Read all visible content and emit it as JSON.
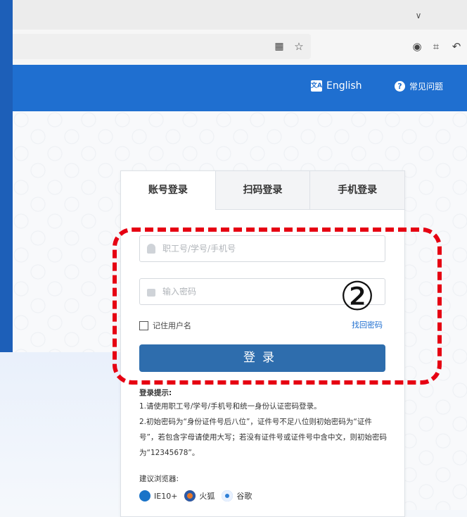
{
  "browser": {
    "tab_chevron_icon": "chevron-down-icon",
    "toolbar_icons": [
      "qr-code-icon",
      "star-icon",
      "account-icon",
      "crop-icon",
      "back-icon"
    ]
  },
  "header": {
    "english_label": "English",
    "faq_label": "常见问题",
    "background_color": "#1f6fd0"
  },
  "login": {
    "tabs": [
      "账号登录",
      "扫码登录",
      "手机登录"
    ],
    "active_tab": 0,
    "username_placeholder": "职工号/学号/手机号",
    "password_placeholder": "输入密码",
    "remember_label": "记住用户名",
    "forgot_label": "找回密码",
    "submit_label": "登录",
    "button_color": "#2e6dad"
  },
  "tips": {
    "title": "登录提示:",
    "line1": "1.请使用职工号/学号/手机号和统一身份认证密码登录。",
    "line2": "2.初始密码为“身份证件号后八位”，证件号不足八位则初始密码为“证件号”，若包含字母请使用大写；若没有证件号或证件号中含中文，则初始密码为“12345678”。"
  },
  "browsers": {
    "title": "建议浏览器:",
    "items": [
      {
        "name": "IE10+",
        "icon": "ie-icon"
      },
      {
        "name": "火狐",
        "icon": "firefox-icon"
      },
      {
        "name": "谷歌",
        "icon": "chrome-icon"
      }
    ]
  },
  "annotation": {
    "step_number": "②",
    "color": "#e60012"
  }
}
